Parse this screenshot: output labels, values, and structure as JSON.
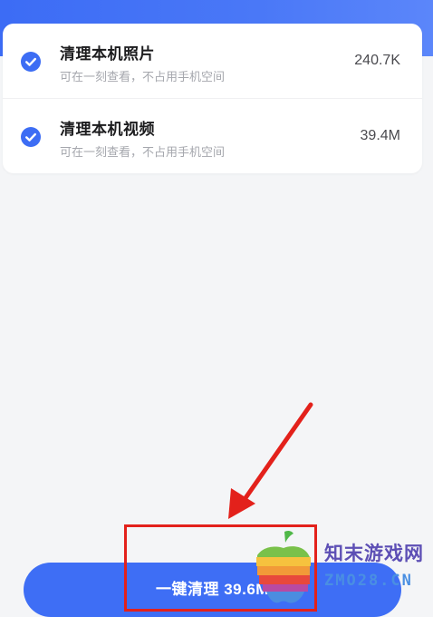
{
  "items": [
    {
      "title": "清理本机照片",
      "subtitle": "可在一刻查看，不占用手机空间",
      "size": "240.7K",
      "checked": true
    },
    {
      "title": "清理本机视频",
      "subtitle": "可在一刻查看，不占用手机空间",
      "size": "39.4M",
      "checked": true
    }
  ],
  "clean_button": {
    "label": "一键清理 39.6M"
  },
  "watermark": {
    "line1": "知末游戏网",
    "line2": "ZMO28.CN"
  },
  "colors": {
    "accent": "#3e6ef5",
    "annotation": "#e3211b"
  }
}
